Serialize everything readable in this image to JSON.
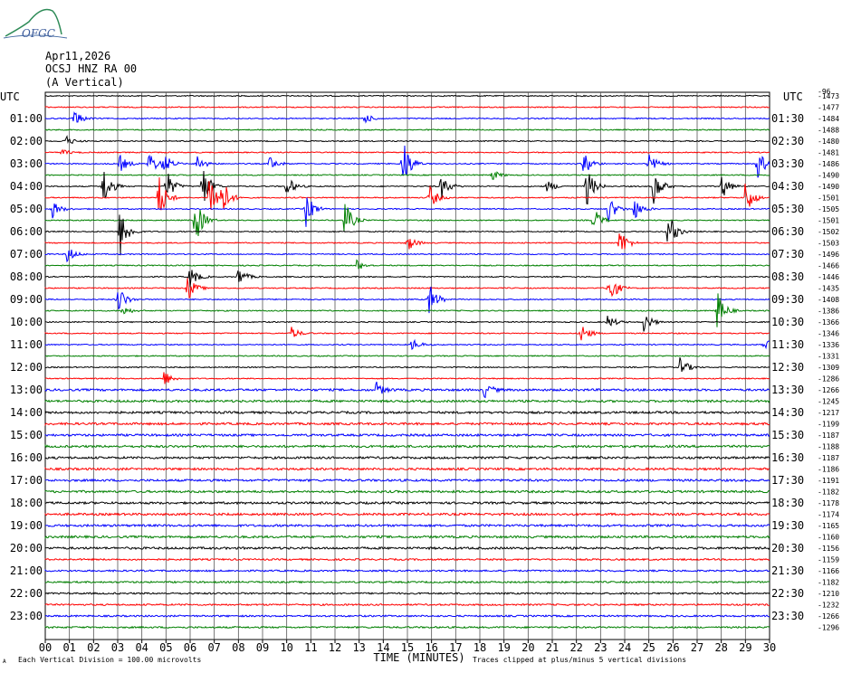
{
  "header": {
    "logo_text": "OFGC",
    "date": "Apr11,2026",
    "station": "OCSJ HNZ RA 00",
    "component": "(A Vertical)"
  },
  "chart_data": {
    "type": "line",
    "title": "",
    "left_axis_title": "UTC",
    "right_axis_title": "UTC",
    "right_axis_top_value": "-96",
    "left_hour_labels": [
      "01:00",
      "02:00",
      "03:00",
      "04:00",
      "05:00",
      "06:00",
      "07:00",
      "08:00",
      "09:00",
      "10:00",
      "11:00",
      "12:00",
      "13:00",
      "14:00",
      "15:00",
      "16:00",
      "17:00",
      "18:00",
      "19:00",
      "20:00",
      "21:00",
      "22:00",
      "23:00"
    ],
    "right_half_labels": [
      "01:30",
      "02:30",
      "03:30",
      "04:30",
      "05:30",
      "06:30",
      "07:30",
      "08:30",
      "09:30",
      "10:30",
      "11:30",
      "12:30",
      "13:30",
      "14:30",
      "15:30",
      "16:30",
      "17:30",
      "18:30",
      "19:30",
      "20:30",
      "21:30",
      "22:30",
      "23:30"
    ],
    "trace_offsets": [
      "-1473",
      "-1477",
      "-1484",
      "-1488",
      "-1480",
      "-1481",
      "-1486",
      "-1490",
      "-1490",
      "-1501",
      "-1505",
      "-1501",
      "-1502",
      "-1503",
      "-1496",
      "-1466",
      "-1446",
      "-1435",
      "-1408",
      "-1386",
      "-1366",
      "-1346",
      "-1336",
      "-1331",
      "-1309",
      "-1286",
      "-1266",
      "-1245",
      "-1217",
      "-1199",
      "-1187",
      "-1188",
      "-1187",
      "-1186",
      "-1191",
      "-1182",
      "-1178",
      "-1174",
      "-1165",
      "-1160",
      "-1156",
      "-1159",
      "-1166",
      "-1182",
      "-1210",
      "-1232",
      "-1266",
      "-1296"
    ],
    "trace_colors": [
      "#000000",
      "#ff0000",
      "#0000ff",
      "#008000"
    ],
    "x_ticks": [
      "00",
      "01",
      "02",
      "03",
      "04",
      "05",
      "06",
      "07",
      "08",
      "09",
      "10",
      "11",
      "12",
      "13",
      "14",
      "15",
      "16",
      "17",
      "18",
      "19",
      "20",
      "21",
      "22",
      "23",
      "24",
      "25",
      "26",
      "27",
      "28",
      "29",
      "30"
    ],
    "xlabel": "TIME (MINUTES)",
    "xlim": [
      0,
      30
    ],
    "traces_per_hour": 2,
    "minutes_per_trace": 30,
    "vertical_grid": true,
    "bursts": [
      {
        "trace": 2,
        "minute": 1.2,
        "amp": 0.8
      },
      {
        "trace": 2,
        "minute": 13.2,
        "amp": 0.5
      },
      {
        "trace": 4,
        "minute": 0.8,
        "amp": 0.6
      },
      {
        "trace": 5,
        "minute": 0.7,
        "amp": 0.3
      },
      {
        "trace": 6,
        "minute": 14.8,
        "amp": 2.6
      },
      {
        "trace": 6,
        "minute": 3.1,
        "amp": 0.8
      },
      {
        "trace": 6,
        "minute": 4.3,
        "amp": 1.2
      },
      {
        "trace": 6,
        "minute": 4.9,
        "amp": 1.0
      },
      {
        "trace": 6,
        "minute": 6.3,
        "amp": 0.8
      },
      {
        "trace": 6,
        "minute": 9.3,
        "amp": 0.7
      },
      {
        "trace": 6,
        "minute": 22.3,
        "amp": 1.2
      },
      {
        "trace": 6,
        "minute": 25.0,
        "amp": 1.0
      },
      {
        "trace": 6,
        "minute": 29.5,
        "amp": 1.5
      },
      {
        "trace": 7,
        "minute": 18.5,
        "amp": 0.5
      },
      {
        "trace": 8,
        "minute": 2.4,
        "amp": 2.0
      },
      {
        "trace": 8,
        "minute": 5.0,
        "amp": 1.6
      },
      {
        "trace": 8,
        "minute": 6.5,
        "amp": 2.2
      },
      {
        "trace": 8,
        "minute": 10.0,
        "amp": 1.0
      },
      {
        "trace": 8,
        "minute": 16.4,
        "amp": 1.2
      },
      {
        "trace": 8,
        "minute": 20.8,
        "amp": 0.6
      },
      {
        "trace": 8,
        "minute": 22.4,
        "amp": 2.0
      },
      {
        "trace": 8,
        "minute": 25.2,
        "amp": 1.8
      },
      {
        "trace": 8,
        "minute": 28.0,
        "amp": 1.3
      },
      {
        "trace": 9,
        "minute": 4.7,
        "amp": 2.2
      },
      {
        "trace": 9,
        "minute": 6.8,
        "amp": 2.6
      },
      {
        "trace": 9,
        "minute": 7.3,
        "amp": 1.8
      },
      {
        "trace": 9,
        "minute": 15.9,
        "amp": 1.2
      },
      {
        "trace": 9,
        "minute": 29.0,
        "amp": 1.7
      },
      {
        "trace": 10,
        "minute": 0.3,
        "amp": 0.8
      },
      {
        "trace": 10,
        "minute": 10.8,
        "amp": 1.6
      },
      {
        "trace": 10,
        "minute": 23.3,
        "amp": 1.4
      },
      {
        "trace": 10,
        "minute": 24.4,
        "amp": 1.0
      },
      {
        "trace": 11,
        "minute": 6.2,
        "amp": 2.4
      },
      {
        "trace": 11,
        "minute": 12.4,
        "amp": 1.8
      },
      {
        "trace": 11,
        "minute": 22.7,
        "amp": 1.2
      },
      {
        "trace": 12,
        "minute": 3.1,
        "amp": 2.4
      },
      {
        "trace": 12,
        "minute": 25.8,
        "amp": 1.8
      },
      {
        "trace": 13,
        "minute": 15.0,
        "amp": 0.8
      },
      {
        "trace": 13,
        "minute": 23.8,
        "amp": 1.4
      },
      {
        "trace": 14,
        "minute": 0.9,
        "amp": 0.8
      },
      {
        "trace": 15,
        "minute": 12.9,
        "amp": 0.5
      },
      {
        "trace": 16,
        "minute": 6.0,
        "amp": 1.0
      },
      {
        "trace": 16,
        "minute": 8.0,
        "amp": 0.9
      },
      {
        "trace": 17,
        "minute": 5.9,
        "amp": 1.2
      },
      {
        "trace": 17,
        "minute": 23.3,
        "amp": 2.0
      },
      {
        "trace": 18,
        "minute": 15.9,
        "amp": 1.6
      },
      {
        "trace": 18,
        "minute": 3.0,
        "amp": 1.4
      },
      {
        "trace": 19,
        "minute": 27.8,
        "amp": 2.0
      },
      {
        "trace": 19,
        "minute": 3.2,
        "amp": 0.5
      },
      {
        "trace": 20,
        "minute": 24.8,
        "amp": 1.0
      },
      {
        "trace": 20,
        "minute": 23.3,
        "amp": 0.7
      },
      {
        "trace": 21,
        "minute": 22.2,
        "amp": 1.0
      },
      {
        "trace": 21,
        "minute": 10.2,
        "amp": 0.6
      },
      {
        "trace": 22,
        "minute": 15.2,
        "amp": 0.6
      },
      {
        "trace": 22,
        "minute": 29.8,
        "amp": 0.6
      },
      {
        "trace": 24,
        "minute": 26.3,
        "amp": 1.0
      },
      {
        "trace": 25,
        "minute": 4.9,
        "amp": 0.8
      },
      {
        "trace": 26,
        "minute": 13.7,
        "amp": 0.7
      },
      {
        "trace": 26,
        "minute": 18.2,
        "amp": 0.7
      }
    ]
  },
  "footer": {
    "scale_note": "Each Vertical Division =  100.00 microvolts",
    "clip_note": "Traces clipped at plus/minus 5 vertical divisions",
    "corner_mark": "A"
  }
}
